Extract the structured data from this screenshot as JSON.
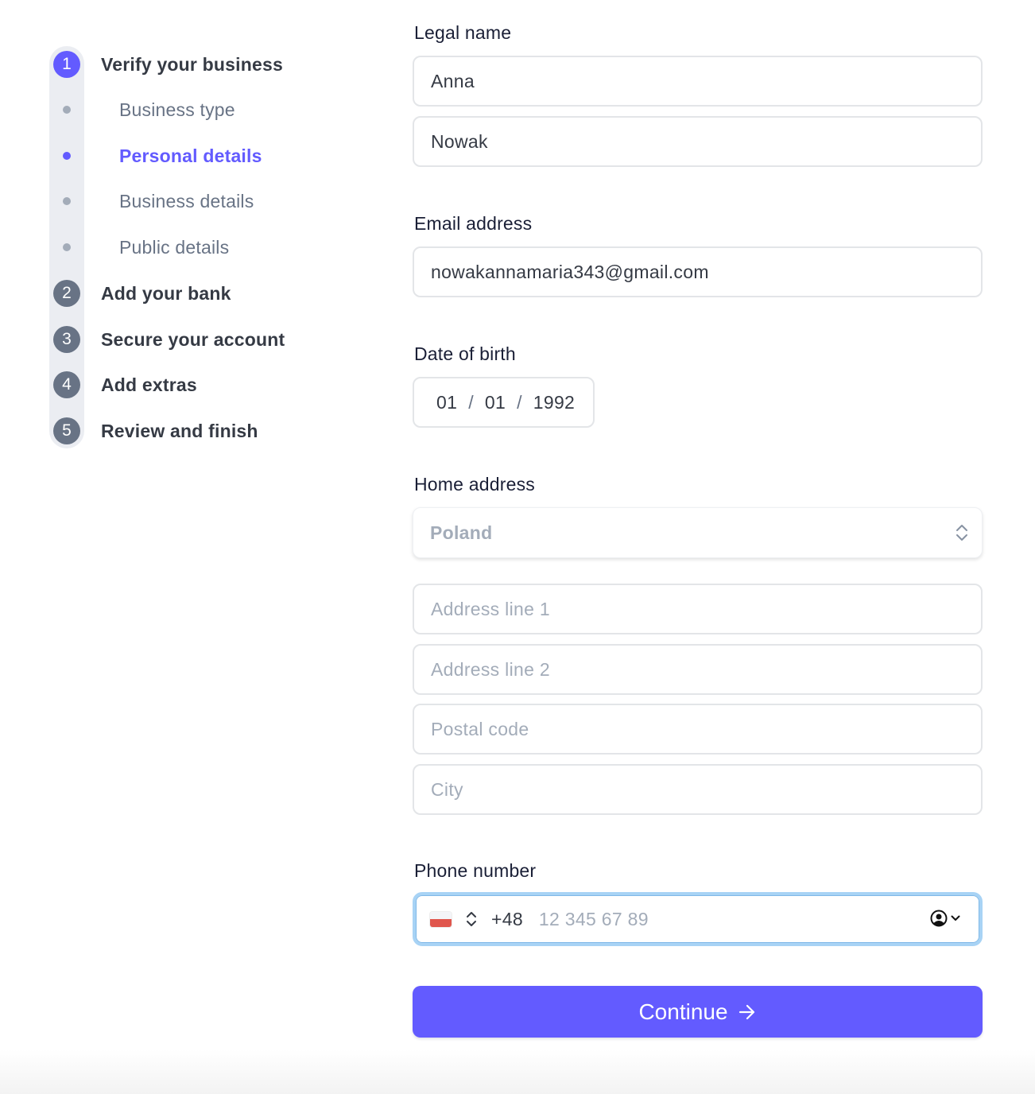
{
  "stepper": {
    "steps": [
      {
        "number": "1",
        "label": "Verify your business",
        "state": "active"
      },
      {
        "number": "2",
        "label": "Add your bank",
        "state": "upcoming"
      },
      {
        "number": "3",
        "label": "Secure your account",
        "state": "upcoming"
      },
      {
        "number": "4",
        "label": "Add extras",
        "state": "upcoming"
      },
      {
        "number": "5",
        "label": "Review and finish",
        "state": "upcoming"
      }
    ],
    "substeps": [
      {
        "label": "Business type",
        "state": "done"
      },
      {
        "label": "Personal details",
        "state": "active"
      },
      {
        "label": "Business details",
        "state": "upcoming"
      },
      {
        "label": "Public details",
        "state": "upcoming"
      }
    ]
  },
  "form": {
    "legal_name": {
      "label": "Legal name",
      "first_name": "Anna",
      "last_name": "Nowak"
    },
    "email": {
      "label": "Email address",
      "value": "nowakannamaria343@gmail.com"
    },
    "dob": {
      "label": "Date of birth",
      "day": "01",
      "month": "01",
      "year": "1992",
      "separator": "/"
    },
    "address": {
      "label": "Home address",
      "country": "Poland",
      "line1_placeholder": "Address line 1",
      "line2_placeholder": "Address line 2",
      "postal_placeholder": "Postal code",
      "city_placeholder": "City"
    },
    "phone": {
      "label": "Phone number",
      "country_code": "+48",
      "placeholder": "12 345 67 89",
      "flag": "poland-flag"
    },
    "continue_label": "Continue"
  },
  "colors": {
    "accent": "#635bff",
    "step_inactive": "#687385",
    "rail": "#ebedf2",
    "focus_ring": "#a8d3f5"
  }
}
